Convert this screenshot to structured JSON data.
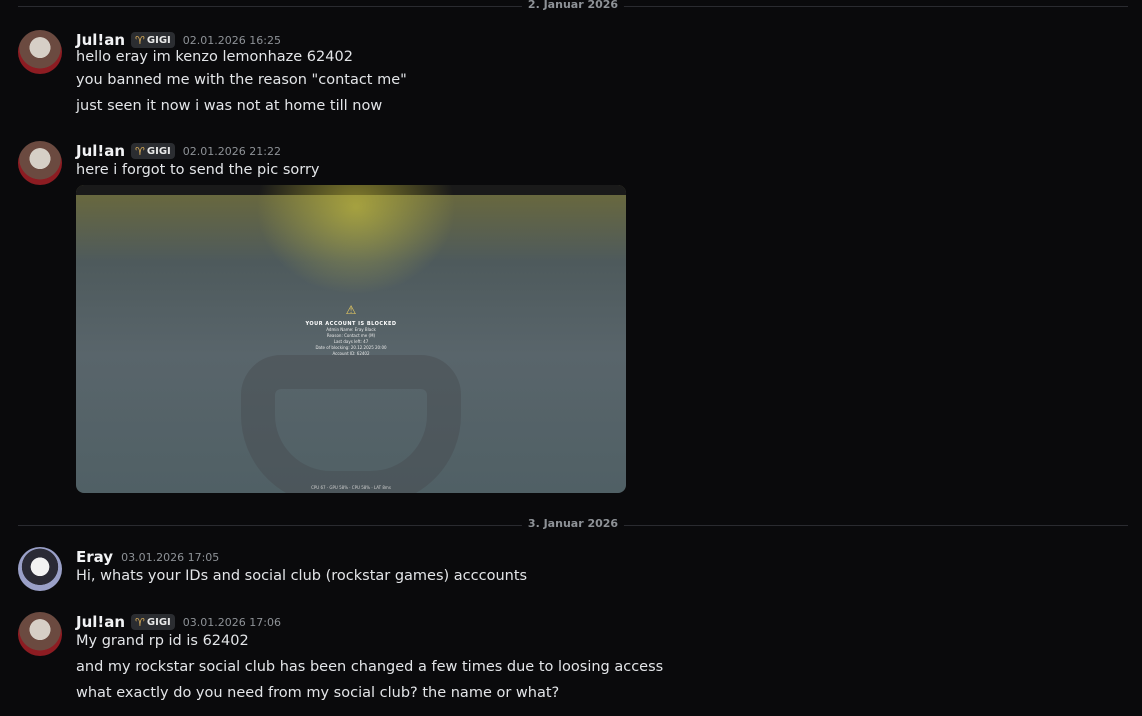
{
  "dividers": [
    "2. Januar 2026",
    "3. Januar 2026"
  ],
  "messages": [
    {
      "author": "Jul!an",
      "tag": "GIGI",
      "time": "02.01.2026 16:25",
      "lines": [
        "hello eray im kenzo lemonhaze 62402",
        "you banned me with the reason \"contact me\"",
        "just seen it now i was not at home till now"
      ]
    },
    {
      "author": "Jul!an",
      "tag": "GIGI",
      "time": "02.01.2026 21:22",
      "lines": [
        "here i forgot to send the pic sorry"
      ],
      "attachment": {
        "title": "YOUR ACCOUNT IS BLOCKED",
        "lines": [
          "Admin Name: Eray Black",
          "Reason: Contact me (M)",
          "Last days left: 47",
          "Date of blocking: 20.12.2025 20:00",
          "Account ID: 62402"
        ],
        "footer": "CPU 67 · GPU 58% · CPU 58% · LAT 8ms"
      }
    },
    {
      "author": "Eray",
      "time": "03.01.2026 17:05",
      "lines": [
        "Hi, whats your IDs and social club (rockstar games) acccounts"
      ]
    },
    {
      "author": "Jul!an",
      "tag": "GIGI",
      "time": "03.01.2026 17:06",
      "lines": [
        "My grand rp id is 62402",
        "and my rockstar social club has been changed a few times due to loosing access",
        "what exactly do you need from my social club? the name or what?"
      ]
    }
  ],
  "icons": {
    "role_tag": "deer-antlers-icon",
    "warning": "warning-triangle-icon"
  },
  "colors": {
    "background": "#0a0a0c",
    "text": "#e3e5e8",
    "muted": "#8e9297",
    "tag_icon": "#e0b15a"
  }
}
